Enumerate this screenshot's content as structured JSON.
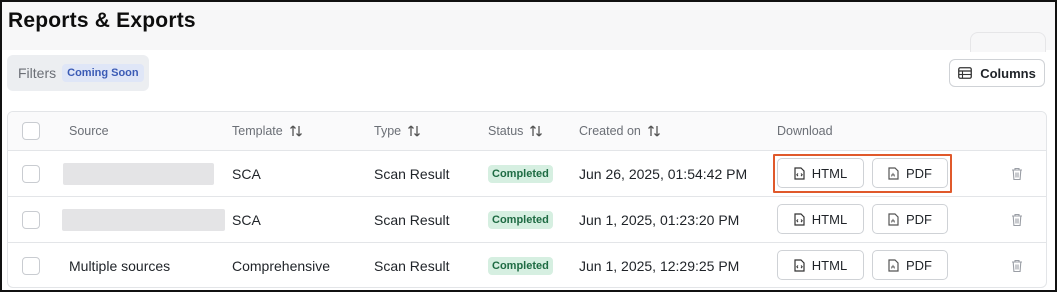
{
  "page": {
    "title": "Reports & Exports"
  },
  "filters": {
    "label": "Filters",
    "badge": "Coming Soon"
  },
  "toolbar": {
    "columns_label": "Columns"
  },
  "table": {
    "headers": {
      "source": "Source",
      "template": "Template",
      "type": "Type",
      "status": "Status",
      "created": "Created on",
      "download": "Download"
    },
    "rows": [
      {
        "source": "",
        "template": "SCA",
        "type": "Scan Result",
        "status": "Completed",
        "created": "Jun 26, 2025, 01:54:42 PM",
        "html": "HTML",
        "pdf": "PDF"
      },
      {
        "source": "",
        "template": "SCA",
        "type": "Scan Result",
        "status": "Completed",
        "created": "Jun 1, 2025, 01:23:20 PM",
        "html": "HTML",
        "pdf": "PDF"
      },
      {
        "source": "Multiple sources",
        "template": "Comprehensive",
        "type": "Scan Result",
        "status": "Completed",
        "created": "Jun 1, 2025, 12:29:25 PM",
        "html": "HTML",
        "pdf": "PDF"
      }
    ]
  },
  "icons": {
    "columns": "table-icon",
    "sort": "sort-arrows-icon",
    "html_file": "file-code-icon",
    "pdf_file": "file-pdf-icon",
    "delete": "trash-icon"
  },
  "colors": {
    "status_bg": "#d6efe1",
    "status_text": "#1e6b43",
    "coming_soon_bg": "#dfe6f7",
    "coming_soon_text": "#3b5bb5",
    "highlight": "#e0592b"
  }
}
